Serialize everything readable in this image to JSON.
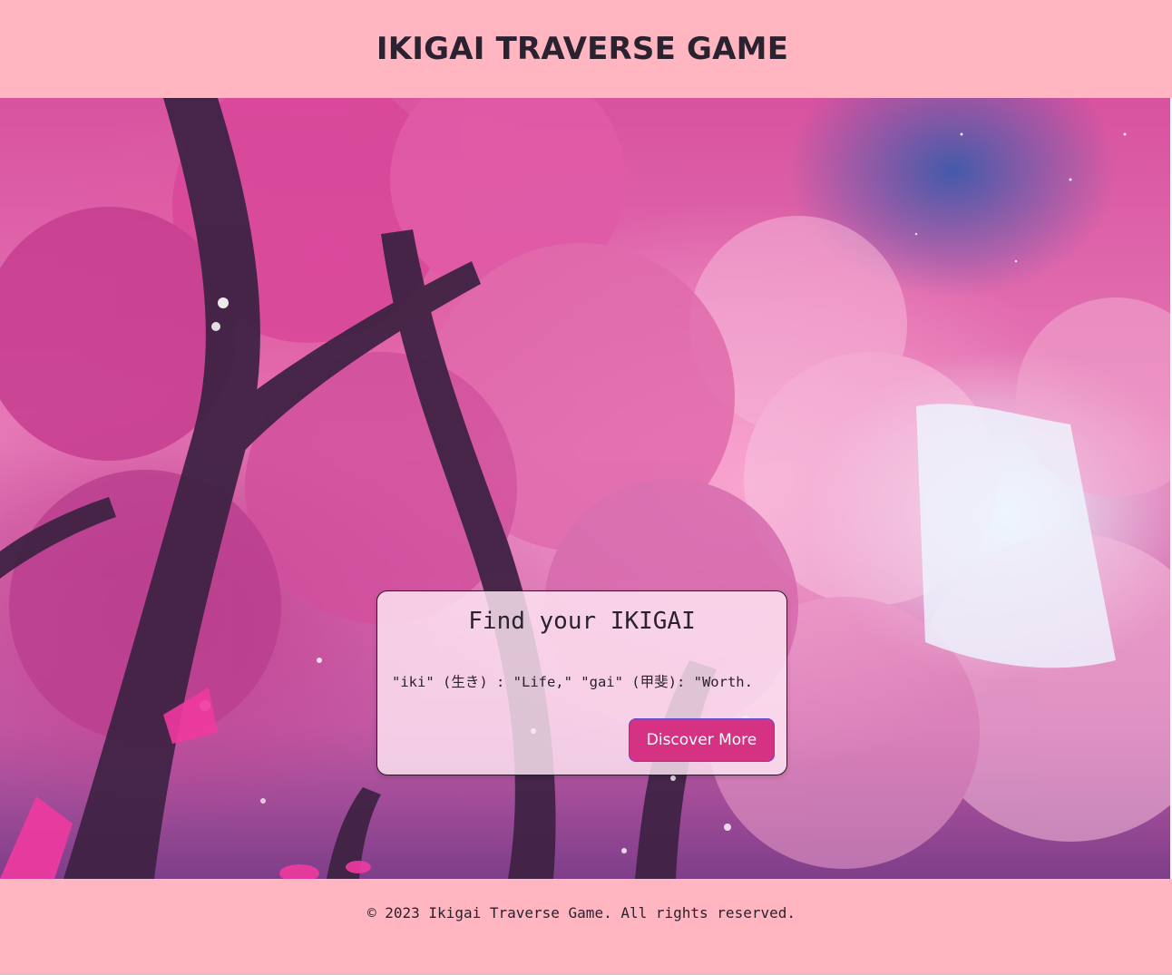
{
  "header": {
    "title": "IKIGAI TRAVERSE GAME"
  },
  "hero": {
    "background_image": "cherry-blossom-forest-image",
    "colors": {
      "blossom": "#e77bb8",
      "sky": "#3c5aaa",
      "trunk": "#4a2a4a"
    },
    "card": {
      "heading": "Find your IKIGAI",
      "text": "\"iki\" (生き) : \"Life,\" \"gai\" (甲斐): \"Worth.",
      "button_label": "Discover More"
    }
  },
  "footer": {
    "text": "© 2023 Ikigai Traverse Game. All rights reserved."
  },
  "colors": {
    "page_background": "#ffb6c1",
    "button_background": "#d63283",
    "button_border": "#5a4ad0",
    "text": "#2a2230"
  }
}
